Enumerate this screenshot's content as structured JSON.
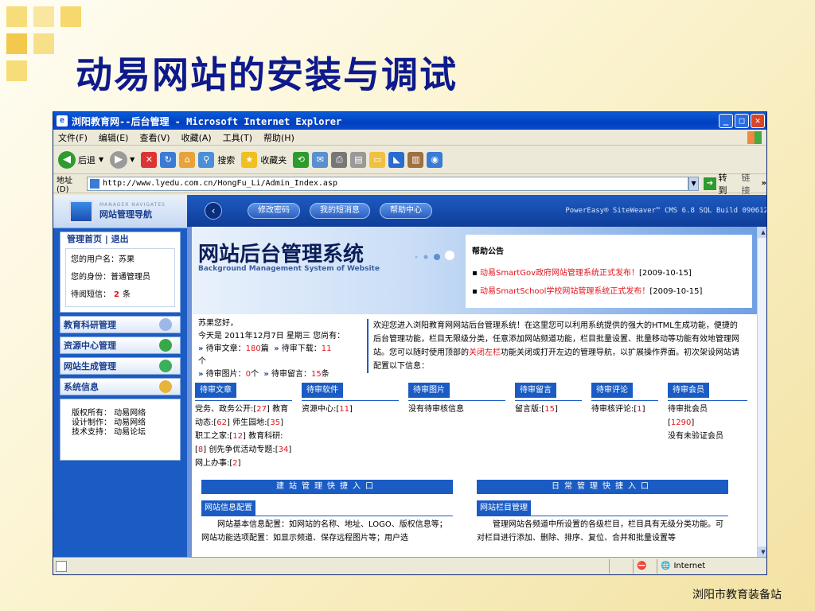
{
  "slide": {
    "title": "动易网站的安装与调试",
    "footer": "浏阳市教育装备站"
  },
  "window": {
    "title": "浏阳教育网--后台管理 - Microsoft Internet Explorer",
    "menu": [
      "文件(F)",
      "编辑(E)",
      "查看(V)",
      "收藏(A)",
      "工具(T)",
      "帮助(H)"
    ],
    "toolbar": {
      "back": "后退",
      "search": "搜索",
      "favorites": "收藏夹"
    },
    "address_label": "地址(D)",
    "address_url": "http://www.lyedu.com.cn/HongFu_Li/Admin_Index.asp",
    "go_label": "转到",
    "links_label": "链接",
    "status_zone": "Internet"
  },
  "leftnav": {
    "brand_en": "MANAGER NAVIGATES",
    "brand_cn": "网站管理导航",
    "top_links": "管理首页 | 退出",
    "username_label": "您的用户名：",
    "username": "苏果",
    "role_label": "您的身份：",
    "role": "普通管理员",
    "msg_label": "待阅短信：",
    "msg_count": "2",
    "msg_unit": "条",
    "sections": [
      "教育科研管理",
      "资源中心管理",
      "网站生成管理",
      "系统信息"
    ],
    "footer_lines": [
      "版权所有： 动易网络",
      "设计制作： 动易网络",
      "技术支持： 动易论坛"
    ]
  },
  "sitebar": {
    "buttons": [
      "修改密码",
      "我的短消息",
      "帮助中心"
    ],
    "powered": "PowerEasy® SiteWeaver™ CMS 6.8 SQL Build 090612"
  },
  "banner": {
    "title": "网站后台管理系统",
    "subtitle": "Background Management System of Website",
    "notice_title": "帮助公告",
    "notices": [
      {
        "text": "动易SmartGov政府网站管理系统正式发布！",
        "date": "[2009-10-15]"
      },
      {
        "text": "动易SmartSchool学校网站管理系统正式发布！",
        "date": "[2009-10-15]"
      }
    ]
  },
  "welcome": {
    "greet": "苏果您好，",
    "today_prefix": "今天是 2011年12月7日 星期三 您尚有：",
    "articles_label": "待审文章：",
    "articles": "180",
    "articles_unit": "篇",
    "downloads_label": "待审下载：",
    "downloads": "11",
    "downloads_unit": "个",
    "images_label": "待审图片：",
    "images": "0",
    "images_unit": "个",
    "messages_label": "待审留言：",
    "messages": "15",
    "messages_unit": "条"
  },
  "intro": {
    "text1": "欢迎您进入浏阳教育网网站后台管理系统！在这里您可以利用系统提供的强大的HTML生成功能，便捷的后台管理功能，栏目无限级分类，任意添加网站频道功能，栏目批量设置、批量移动等功能有效地管理网站。您可以随时使用顶部的",
    "link": "关闭左栏",
    "text2": "功能关闭或打开左边的管理导航，以扩展操作界面。初次架设网站请配置以下信息："
  },
  "pending": {
    "articles": {
      "header": "待审文章",
      "items": [
        {
          "label": "党务、政务公开",
          "count": "27"
        },
        {
          "label": "教育动态",
          "count": "62"
        },
        {
          "label": "师生园地",
          "count": "35"
        },
        {
          "label": "职工之家",
          "count": "12"
        },
        {
          "label": "教育科研",
          "count": "8"
        },
        {
          "label": "创先争优活动专题",
          "count": "34"
        },
        {
          "label": "网上办事",
          "count": "2"
        }
      ]
    },
    "software": {
      "header": "待审软件",
      "label": "资源中心",
      "count": "11"
    },
    "images": {
      "header": "待审图片",
      "text": "没有待审核信息"
    },
    "messages": {
      "header": "待审留言",
      "label": "留言版",
      "count": "15"
    },
    "comments": {
      "header": "待审评论",
      "label": "待审核评论",
      "count": "1"
    },
    "members": {
      "header": "待审会员",
      "label": "待审批会员",
      "count": "1290",
      "extra": "没有未验证会员"
    }
  },
  "quick": {
    "left_bar": "建站管理快捷入口",
    "right_bar": "日常管理快捷入口",
    "left_header": "网站信息配置",
    "left_text": "网站基本信息配置：如网站的名称、地址、LOGO、版权信息等；网站功能选项配置：如显示频道、保存远程图片等；用户选",
    "right_header": "网站栏目管理",
    "right_text": "管理网站各频道中所设置的各级栏目，栏目具有无级分类功能。可对栏目进行添加、删除、排序、复位、合并和批量设置等"
  },
  "colors": {
    "title_blue": "#0e1a8c",
    "panel_blue": "#1b5cc4",
    "alert_red": "#e2141d",
    "deco_yellow": "#f2c94c"
  }
}
